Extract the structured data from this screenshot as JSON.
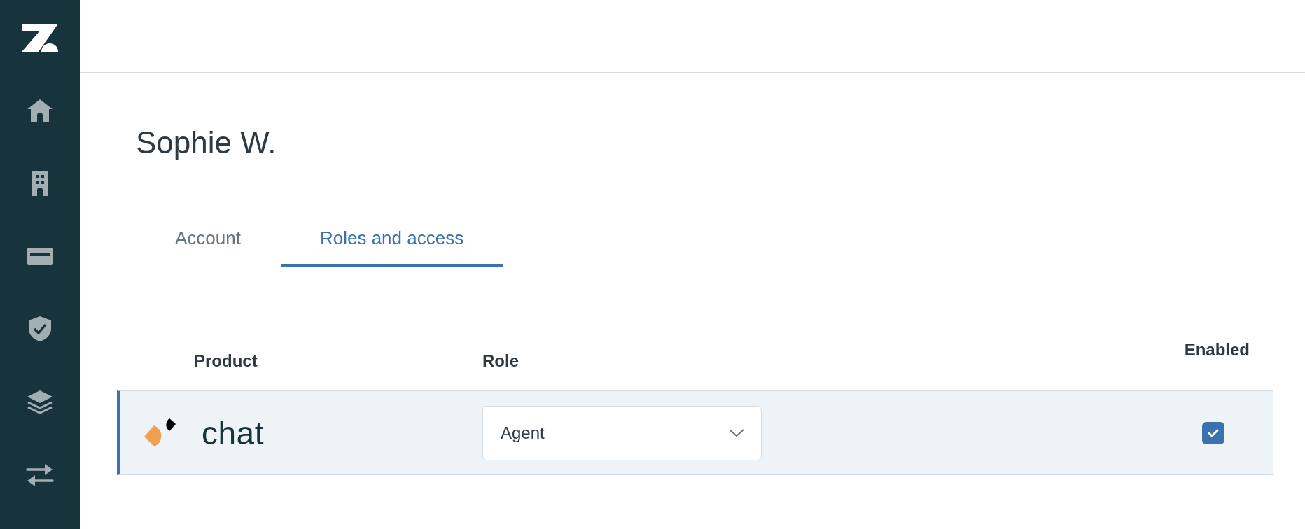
{
  "user": {
    "name": "Sophie W."
  },
  "tabs": [
    {
      "label": "Account",
      "selected": false
    },
    {
      "label": "Roles and access",
      "selected": true
    }
  ],
  "table": {
    "columns": [
      "Product",
      "Role",
      "Enabled"
    ],
    "rows": [
      {
        "product": "chat",
        "role": "Agent",
        "enabled": true,
        "selected": true
      }
    ]
  }
}
